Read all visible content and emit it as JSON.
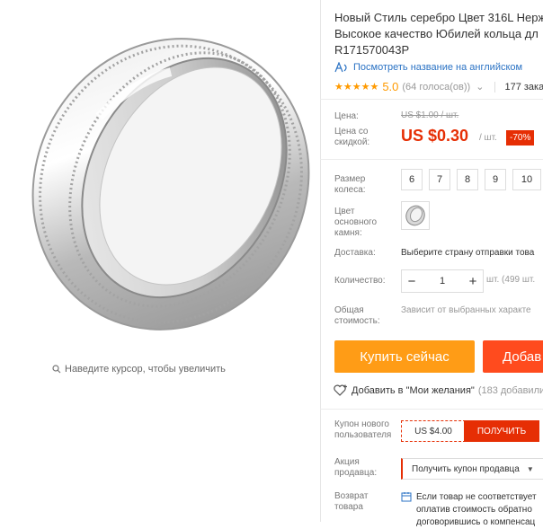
{
  "gallery": {
    "zoom_hint": "Наведите курсор, чтобы увеличить"
  },
  "product": {
    "title_lines": [
      "Новый Стиль серебро Цвет 316L Нерж",
      "Высокое качество Юбилей кольца дл",
      "R171570043P"
    ],
    "english_link": "Посмотреть название на английском",
    "rating_score": "5.0",
    "votes": "(64 голоса(ов))",
    "orders": "177 зака"
  },
  "price": {
    "label": "Цена:",
    "old": "US $1.00 / шт.",
    "discount_label": "Цена со скидкой:",
    "current": "US $0.30",
    "per_unit": "/ шт.",
    "badge": "-70%"
  },
  "size": {
    "label": "Размер колеса:",
    "options": [
      "6",
      "7",
      "8",
      "9",
      "10"
    ]
  },
  "color": {
    "label": "Цвет основного камня:"
  },
  "delivery": {
    "label": "Доставка:",
    "value": "Выберите страну отправки това"
  },
  "quantity": {
    "label": "Количество:",
    "value": "1",
    "minus": "−",
    "plus": "+",
    "note": "шт. (499 шт."
  },
  "total": {
    "label": "Общая стоимость:",
    "value": "Зависит от выбранных характе"
  },
  "actions": {
    "buy_now": "Купить сейчас",
    "add_to_cart": "Добав"
  },
  "wishlist": {
    "label": "Добавить в \"Мои желания\"",
    "count": "(183 добавили"
  },
  "coupon": {
    "label": "Купон нового пользователя",
    "value": "US $4.00",
    "button": "ПОЛУЧИТЬ"
  },
  "seller_promo": {
    "label": "Акция продавца:",
    "select": "Получить купон продавца"
  },
  "returns": {
    "label": "Возврат товара",
    "lines": [
      "Если товар не соответствует",
      "оплатив стоимость обратно",
      "договорившись о компенсац"
    ]
  },
  "colors": {
    "accent": "#e62e04",
    "buy": "#ff9c16",
    "cart": "#ff4b1e",
    "link": "#2a72c4",
    "star": "#ff9a00"
  }
}
